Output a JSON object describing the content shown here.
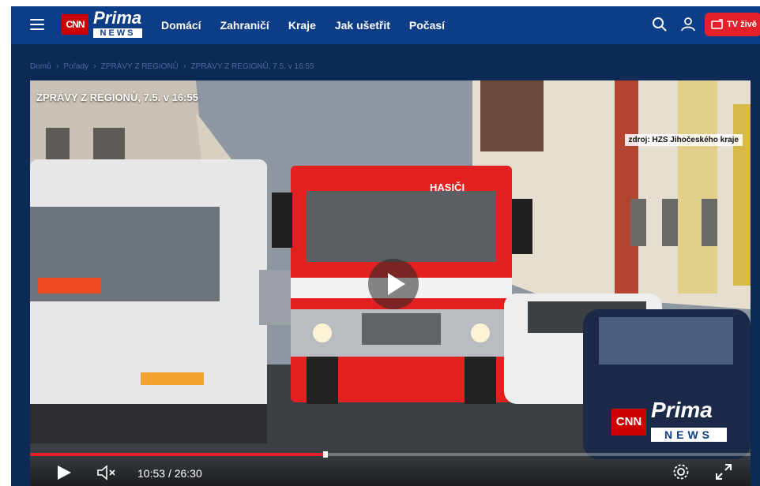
{
  "header": {
    "logo": {
      "cnn": "CNN",
      "prima": "Prima",
      "news": "NEWS"
    },
    "nav": [
      "Domácí",
      "Zahraničí",
      "Kraje",
      "Jak ušetřit",
      "Počasí"
    ],
    "tv_label": "TV živě",
    "icons": [
      "menu-icon",
      "search-icon",
      "user-icon",
      "tv-icon"
    ]
  },
  "breadcrumb": [
    "Domů",
    "Pořady",
    "ZPRÁVY Z REGIONŮ",
    "ZPRÁVY Z REGIONŮ, 7.5. v 16:55"
  ],
  "video": {
    "title": "ZPRÁVY Z REGIONŮ, 7.5. v 16:55",
    "source_caption": "zdroj: HZS Jihočeského kraje",
    "truck_label": "HASIČI",
    "watermark": {
      "cnn": "CNN",
      "prima": "Prima",
      "news": "NEWS"
    },
    "current_time": "10:53",
    "separator": "/",
    "duration": "26:30",
    "progress_fraction": 0.41,
    "colors": {
      "accent": "#e5202a",
      "header": "#0c3d86"
    }
  }
}
